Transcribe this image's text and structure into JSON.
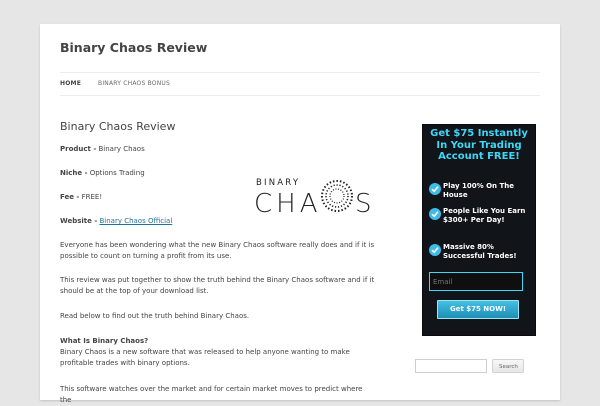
{
  "site": {
    "title": "Binary Chaos Review"
  },
  "nav": {
    "items": [
      {
        "label": "HOME"
      },
      {
        "label": "BINARY CHAOS BONUS"
      }
    ]
  },
  "post": {
    "title": "Binary Chaos Review",
    "product_label": "Product -",
    "product_value": "Binary Chaos",
    "niche_label": "Niche -",
    "niche_value": "Options Trading",
    "fee_label": "Fee -",
    "fee_value": "FREE!",
    "website_label": "Website -",
    "website_link": "Binary Chaos Official",
    "para1": "Everyone has been wondering what the new Binary Chaos software really does and if it is possible to count on turning a profit from its use.",
    "para2": "This review was put together to show the truth behind the Binary Chaos software and if it should be at the top of your download list.",
    "para3": "Read below to find out the truth behind Binary Chaos.",
    "heading_what": "What Is Binary Chaos?",
    "para4": "Binary Chaos is a new software that was released to help anyone wanting to make profitable trades with binary options.",
    "para5": "This software watches over the market and for certain market moves to predict where the"
  },
  "logo": {
    "line1": "BINARY",
    "line2": "CHA",
    "line3": "S"
  },
  "ad": {
    "headline": "Get $75 Instantly In Your Trading Account FREE!",
    "items": [
      {
        "text": "Play 100% On The House"
      },
      {
        "text": "People Like You Earn $300+ Per Day!"
      },
      {
        "text": "Massive  80% Successful Trades!"
      }
    ],
    "email_placeholder": "Email",
    "button_label": "Get $75 NOW!",
    "accent_color": "#3fd7f7"
  },
  "search": {
    "placeholder": "",
    "button_label": "Search"
  },
  "icons": {
    "check": "checkmark-icon"
  }
}
